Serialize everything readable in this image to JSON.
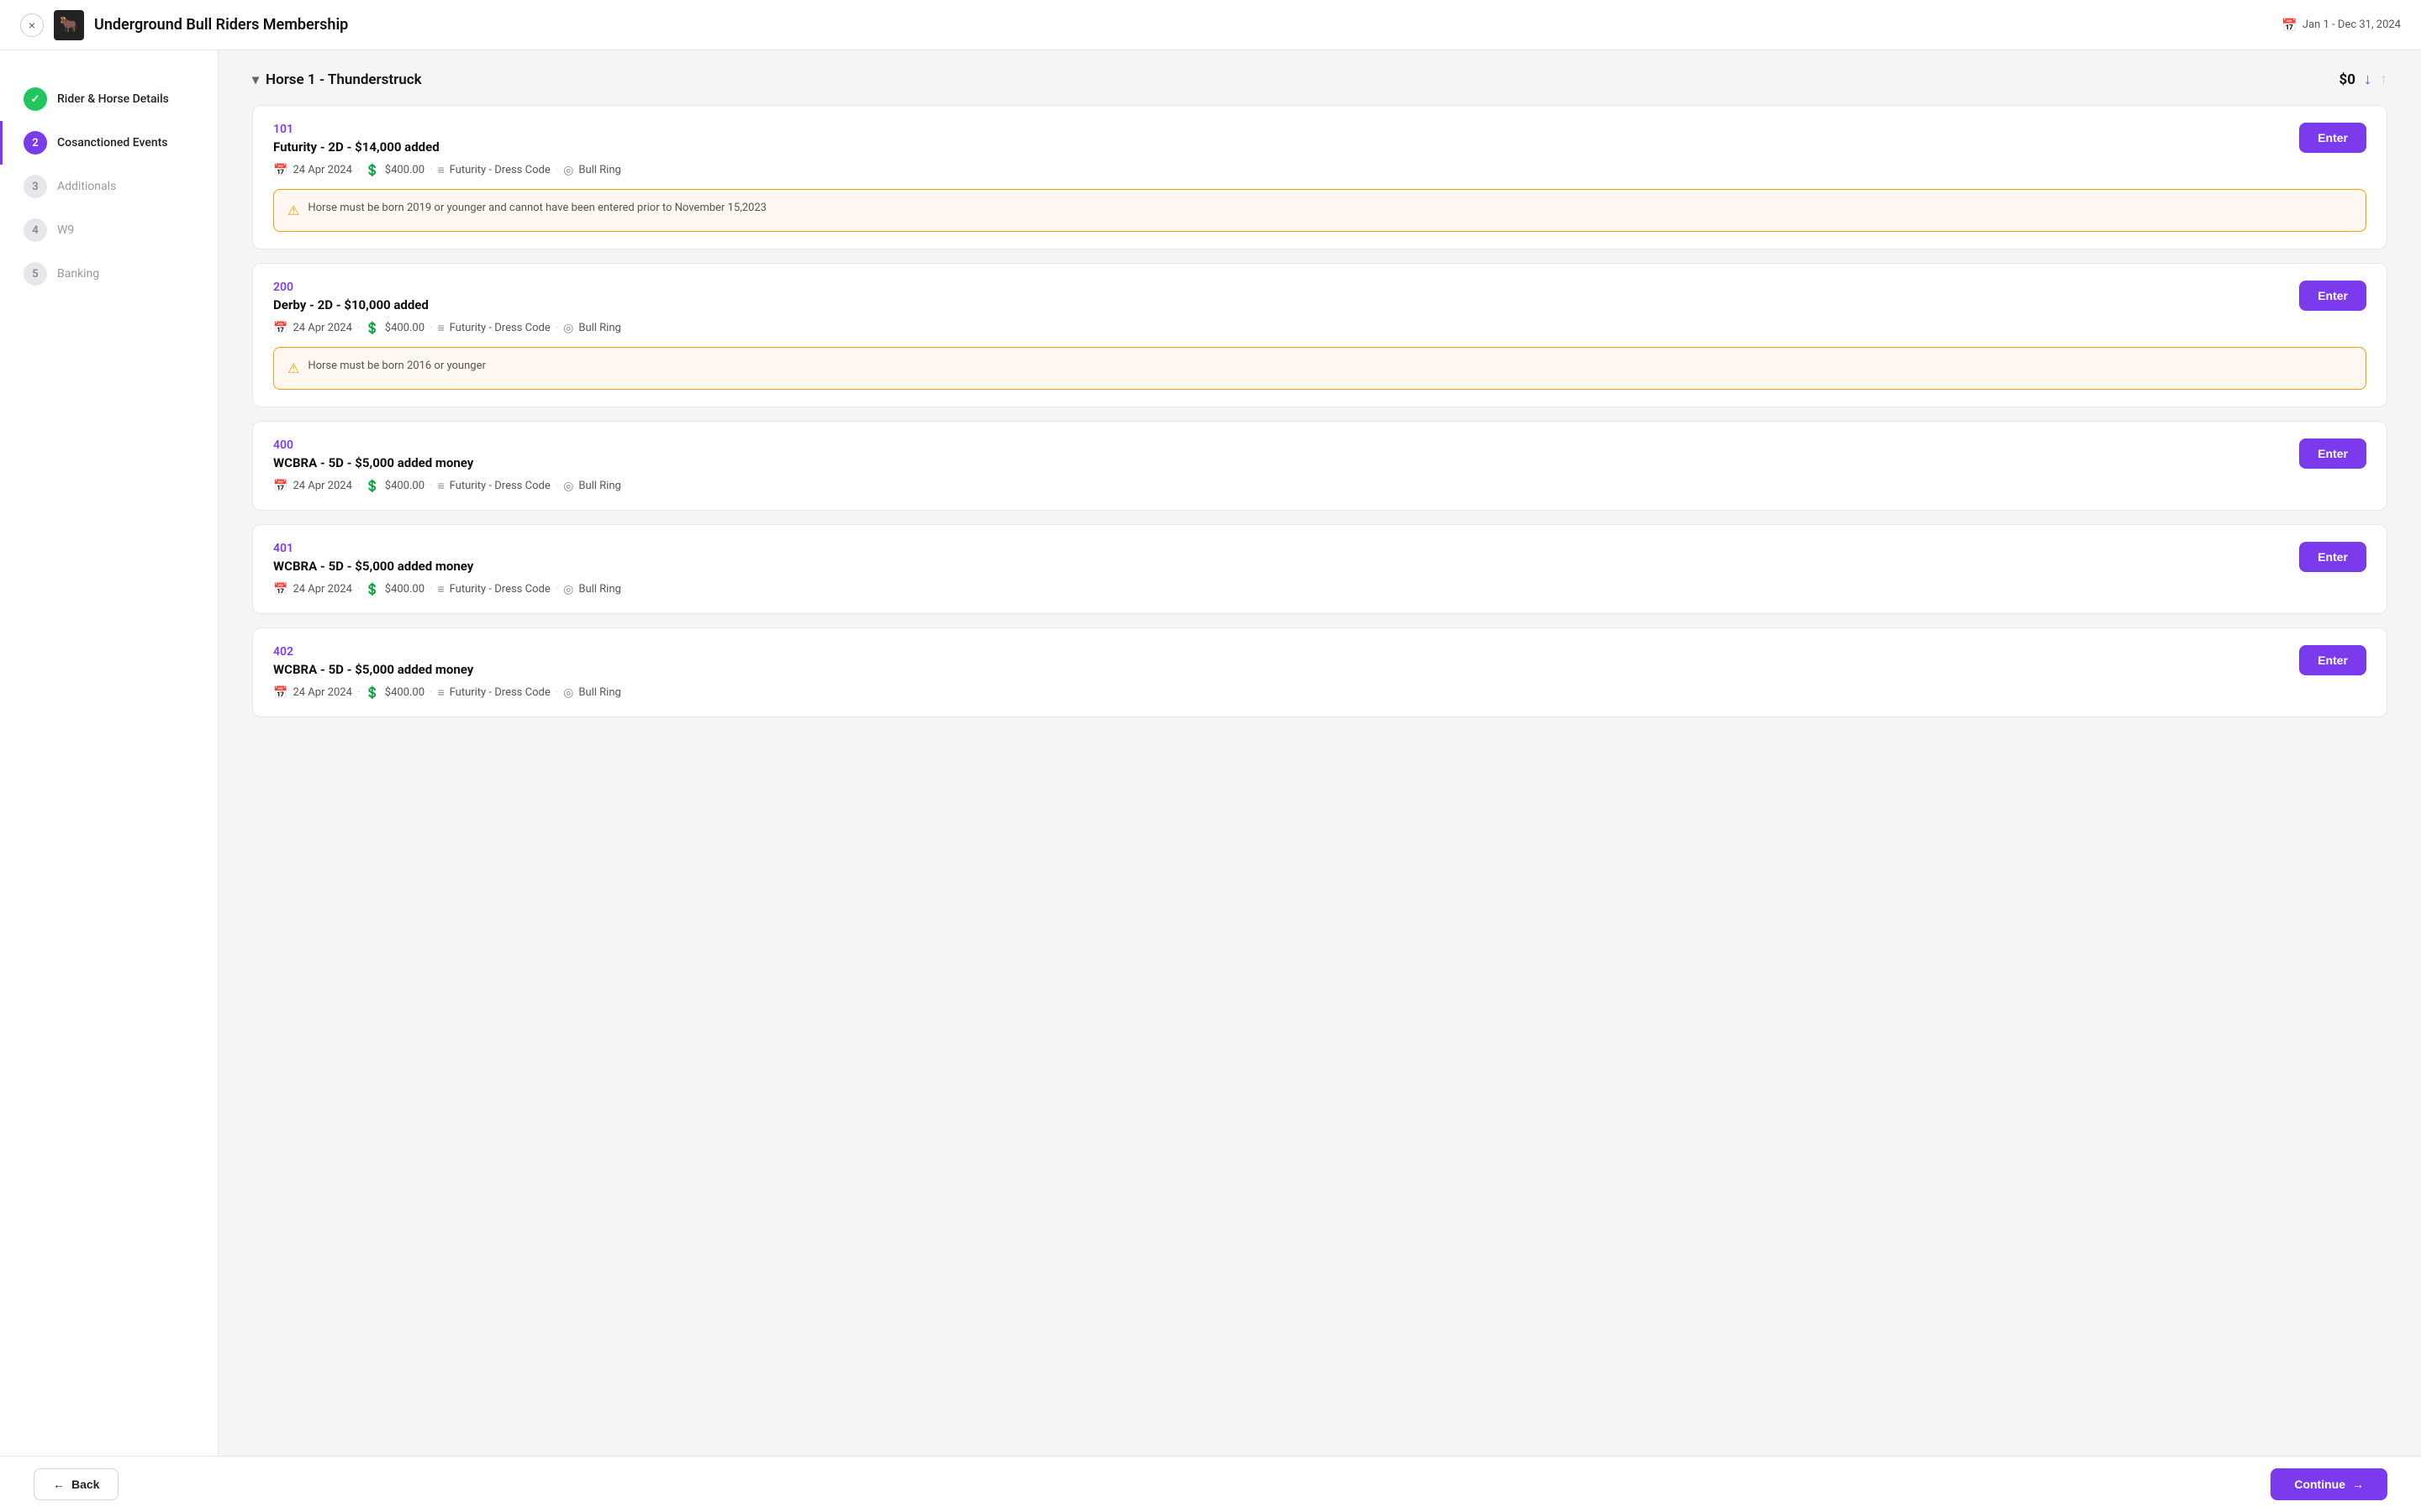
{
  "header": {
    "title": "Underground Bull Riders Membership",
    "date_range": "Jan 1 - Dec 31, 2024",
    "logo_char": "🐂"
  },
  "sidebar": {
    "items": [
      {
        "id": "rider-horse",
        "step": "✓",
        "label": "Rider & Horse Details",
        "state": "done"
      },
      {
        "id": "cosanctioned",
        "step": "2",
        "label": "Cosanctioned Events",
        "state": "active"
      },
      {
        "id": "additionals",
        "step": "3",
        "label": "Additionals",
        "state": "inactive"
      },
      {
        "id": "w9",
        "step": "4",
        "label": "W9",
        "state": "inactive"
      },
      {
        "id": "banking",
        "step": "5",
        "label": "Banking",
        "state": "inactive"
      }
    ]
  },
  "horse_section": {
    "title": "Horse 1 - Thunderstruck",
    "total": "$0",
    "events": [
      {
        "id": "event-101",
        "number": "101",
        "name": "Futurity - 2D - $14,000 added",
        "date": "24 Apr 2024",
        "fee": "$400.00",
        "dress_code": "Futurity - Dress Code",
        "location": "Bull Ring",
        "warning": "Horse must be born 2019 or younger and cannot have been entered prior to November 15,2023",
        "enter_label": "Enter"
      },
      {
        "id": "event-200",
        "number": "200",
        "name": "Derby - 2D - $10,000 added",
        "date": "24 Apr 2024",
        "fee": "$400.00",
        "dress_code": "Futurity - Dress Code",
        "location": "Bull Ring",
        "warning": "Horse must be born 2016 or younger",
        "enter_label": "Enter"
      },
      {
        "id": "event-400",
        "number": "400",
        "name": "WCBRA - 5D - $5,000 added money",
        "date": "24 Apr 2024",
        "fee": "$400.00",
        "dress_code": "Futurity - Dress Code",
        "location": "Bull Ring",
        "warning": null,
        "enter_label": "Enter"
      },
      {
        "id": "event-401",
        "number": "401",
        "name": "WCBRA - 5D - $5,000 added money",
        "date": "24 Apr 2024",
        "fee": "$400.00",
        "dress_code": "Futurity - Dress Code",
        "location": "Bull Ring",
        "warning": null,
        "enter_label": "Enter"
      },
      {
        "id": "event-402",
        "number": "402",
        "name": "WCBRA - 5D - $5,000 added money",
        "date": "24 Apr 2024",
        "fee": "$400.00",
        "dress_code": "Futurity - Dress Code",
        "location": "Bull Ring",
        "warning": null,
        "enter_label": "Enter"
      }
    ]
  },
  "footer": {
    "back_label": "Back",
    "continue_label": "Continue"
  },
  "icons": {
    "close": "×",
    "chevron_down": "▾",
    "arrow_down_purple": "↓",
    "arrow_up_gray": "↑",
    "calendar": "📅",
    "dollar": "💲",
    "layers": "≡",
    "target": "◎",
    "warning": "⚠",
    "arrow_left": "←",
    "arrow_right": "→"
  }
}
